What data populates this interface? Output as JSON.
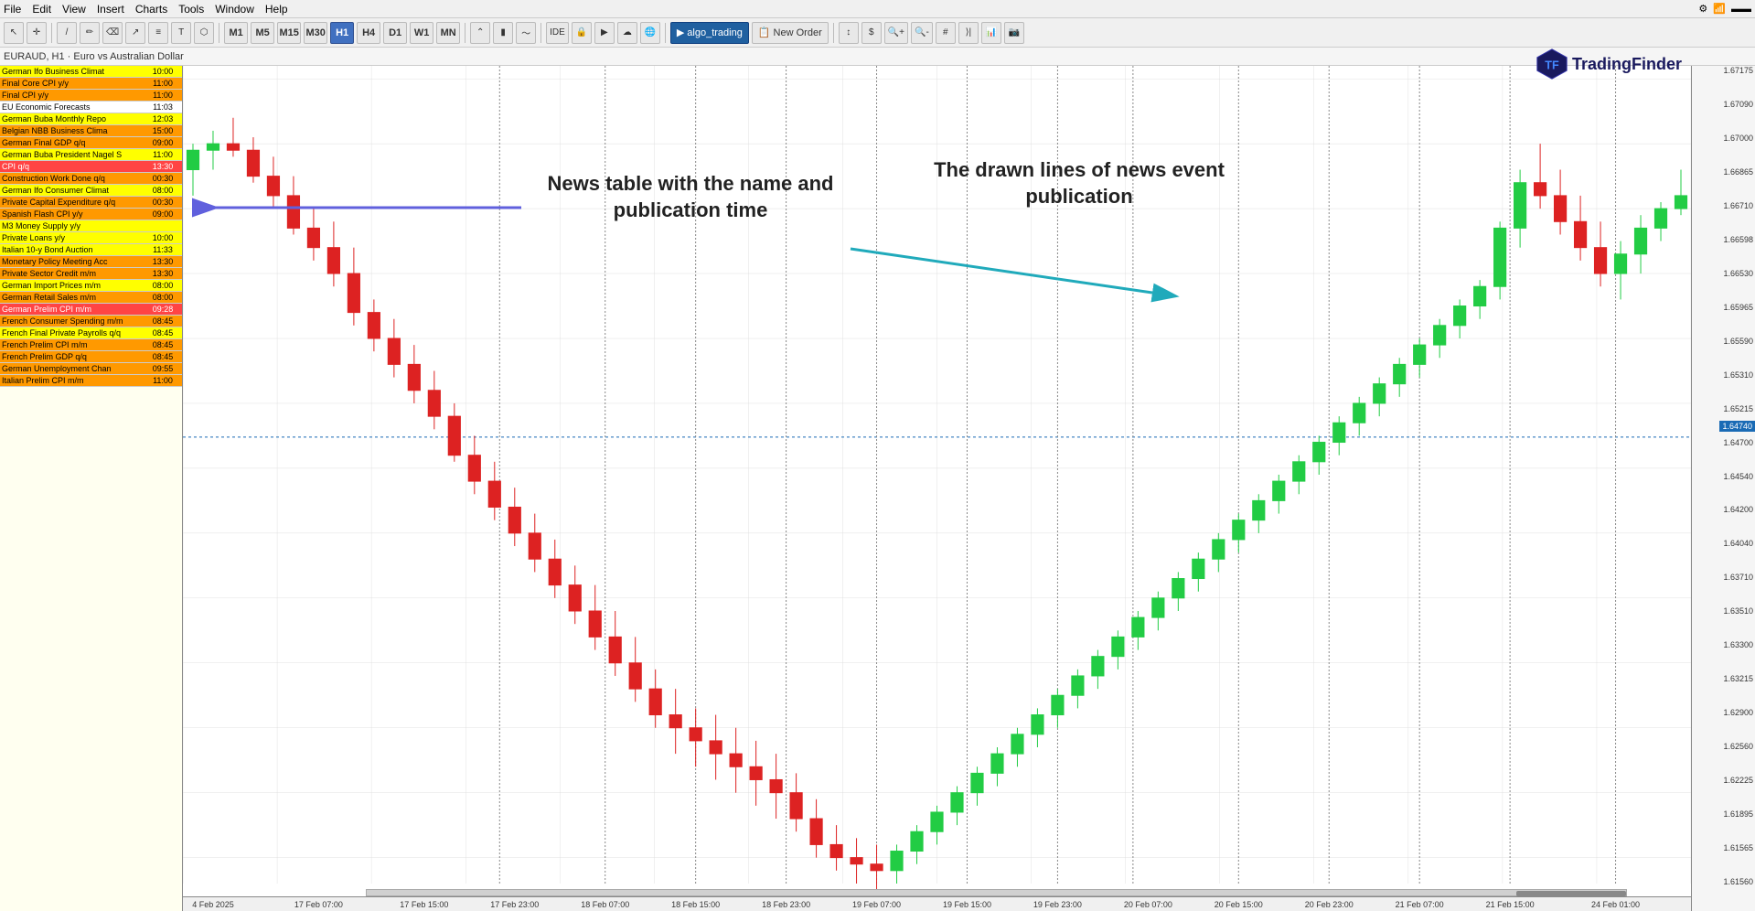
{
  "menubar": {
    "items": [
      "File",
      "Edit",
      "View",
      "Insert",
      "Charts",
      "Tools",
      "Window",
      "Help"
    ]
  },
  "toolbar": {
    "timeframes": [
      "M1",
      "M5",
      "M15",
      "M30",
      "H1",
      "H4",
      "D1",
      "W1",
      "MN"
    ],
    "active_tf": "H1",
    "buttons": [
      "cursor",
      "crosshair",
      "line",
      "pencil",
      "eraser",
      "trend",
      "text",
      "shapes"
    ],
    "right_buttons": [
      "IDE",
      "lock",
      "play",
      "cloud",
      "algo_trading",
      "new_order",
      "arrows",
      "price",
      "zoom_in",
      "zoom_out",
      "grid",
      "autoscroll",
      "indicators",
      "screenshot"
    ]
  },
  "symbol_bar": {
    "text": "EURAUD, H1 · Euro vs Australian Dollar"
  },
  "logo": {
    "text": "TradingFinder"
  },
  "news_table": {
    "rows": [
      {
        "name": "German Ifo Business Climat",
        "time": "10:00",
        "color": "yellow"
      },
      {
        "name": "Final Core CPI y/y",
        "time": "11:00",
        "color": "orange"
      },
      {
        "name": "Final CPI y/y",
        "time": "11:00",
        "color": "orange"
      },
      {
        "name": "EU Economic Forecasts",
        "time": "11:03",
        "color": "white"
      },
      {
        "name": "German Buba Monthly Repo",
        "time": "12:03",
        "color": "yellow"
      },
      {
        "name": "Belgian NBB Business Clima",
        "time": "15:00",
        "color": "orange"
      },
      {
        "name": "German Final GDP q/q",
        "time": "09:00",
        "color": "orange"
      },
      {
        "name": "German Buba President Nagel S",
        "time": "11:00",
        "color": "yellow"
      },
      {
        "name": "CPI q/q",
        "time": "13:30",
        "color": "red"
      },
      {
        "name": "Construction Work Done q/q",
        "time": "00:30",
        "color": "orange"
      },
      {
        "name": "German Ifo Consumer Climat",
        "time": "08:00",
        "color": "yellow"
      },
      {
        "name": "Private Capital Expenditure q/q",
        "time": "00:30",
        "color": "orange"
      },
      {
        "name": "Spanish Flash CPI y/y",
        "time": "09:00",
        "color": "orange"
      },
      {
        "name": "M3 Money Supply y/y",
        "time": "",
        "color": "yellow"
      },
      {
        "name": "Private Loans y/y",
        "time": "10:00",
        "color": "yellow"
      },
      {
        "name": "Italian 10-y Bond Auction",
        "time": "11:33",
        "color": "yellow"
      },
      {
        "name": "Monetary Policy Meeting Acc",
        "time": "13:30",
        "color": "orange"
      },
      {
        "name": "Private Sector Credit m/m",
        "time": "13:30",
        "color": "orange"
      },
      {
        "name": "German Import Prices m/m",
        "time": "08:00",
        "color": "yellow"
      },
      {
        "name": "German Retail Sales m/m",
        "time": "08:00",
        "color": "orange"
      },
      {
        "name": "German Prelim CPI m/m",
        "time": "09:28",
        "color": "red"
      },
      {
        "name": "French Consumer Spending m/m",
        "time": "08:45",
        "color": "orange"
      },
      {
        "name": "French Final Private Payrolls q/q",
        "time": "08:45",
        "color": "yellow"
      },
      {
        "name": "French Prelim CPI m/m",
        "time": "08:45",
        "color": "orange"
      },
      {
        "name": "French Prelim GDP q/q",
        "time": "08:45",
        "color": "orange"
      },
      {
        "name": "German Unemployment Chan",
        "time": "09:55",
        "color": "orange"
      },
      {
        "name": "Italian Prelim CPI m/m",
        "time": "11:00",
        "color": "orange"
      }
    ]
  },
  "annotations": {
    "label1": "News table with the name\nand publication time",
    "label2": "The drawn lines of\nnews event publication"
  },
  "price_axis": {
    "prices": [
      "1.67175",
      "1.67090",
      "1.67000",
      "1.66865",
      "1.66710",
      "1.66598",
      "1.66530",
      "1.65965",
      "1.65590",
      "1.65310",
      "1.65215",
      "1.64700",
      "1.64540",
      "1.64200",
      "1.64040",
      "1.63710",
      "1.63510",
      "1.63300",
      "1.63215",
      "1.62900",
      "1.62560",
      "1.62225",
      "1.61895",
      "1.61565",
      "1.61560"
    ],
    "current": "1.64740"
  },
  "time_axis": {
    "labels": [
      {
        "text": "4 Feb 2025",
        "pct": 2
      },
      {
        "text": "17 Feb 07:00",
        "pct": 9
      },
      {
        "text": "17 Feb 15:00",
        "pct": 16
      },
      {
        "text": "17 Feb 23:00",
        "pct": 22
      },
      {
        "text": "18 Feb 07:00",
        "pct": 28
      },
      {
        "text": "18 Feb 15:00",
        "pct": 34
      },
      {
        "text": "18 Feb 23:00",
        "pct": 40
      },
      {
        "text": "19 Feb 07:00",
        "pct": 46
      },
      {
        "text": "19 Feb 15:00",
        "pct": 52
      },
      {
        "text": "19 Feb 23:00",
        "pct": 58
      },
      {
        "text": "20 Feb 07:00",
        "pct": 64
      },
      {
        "text": "20 Feb 15:00",
        "pct": 70
      },
      {
        "text": "20 Feb 23:00",
        "pct": 76
      },
      {
        "text": "21 Feb 07:00",
        "pct": 82
      },
      {
        "text": "21 Feb 15:00",
        "pct": 88
      },
      {
        "text": "24 Feb 01:00",
        "pct": 95
      }
    ]
  }
}
